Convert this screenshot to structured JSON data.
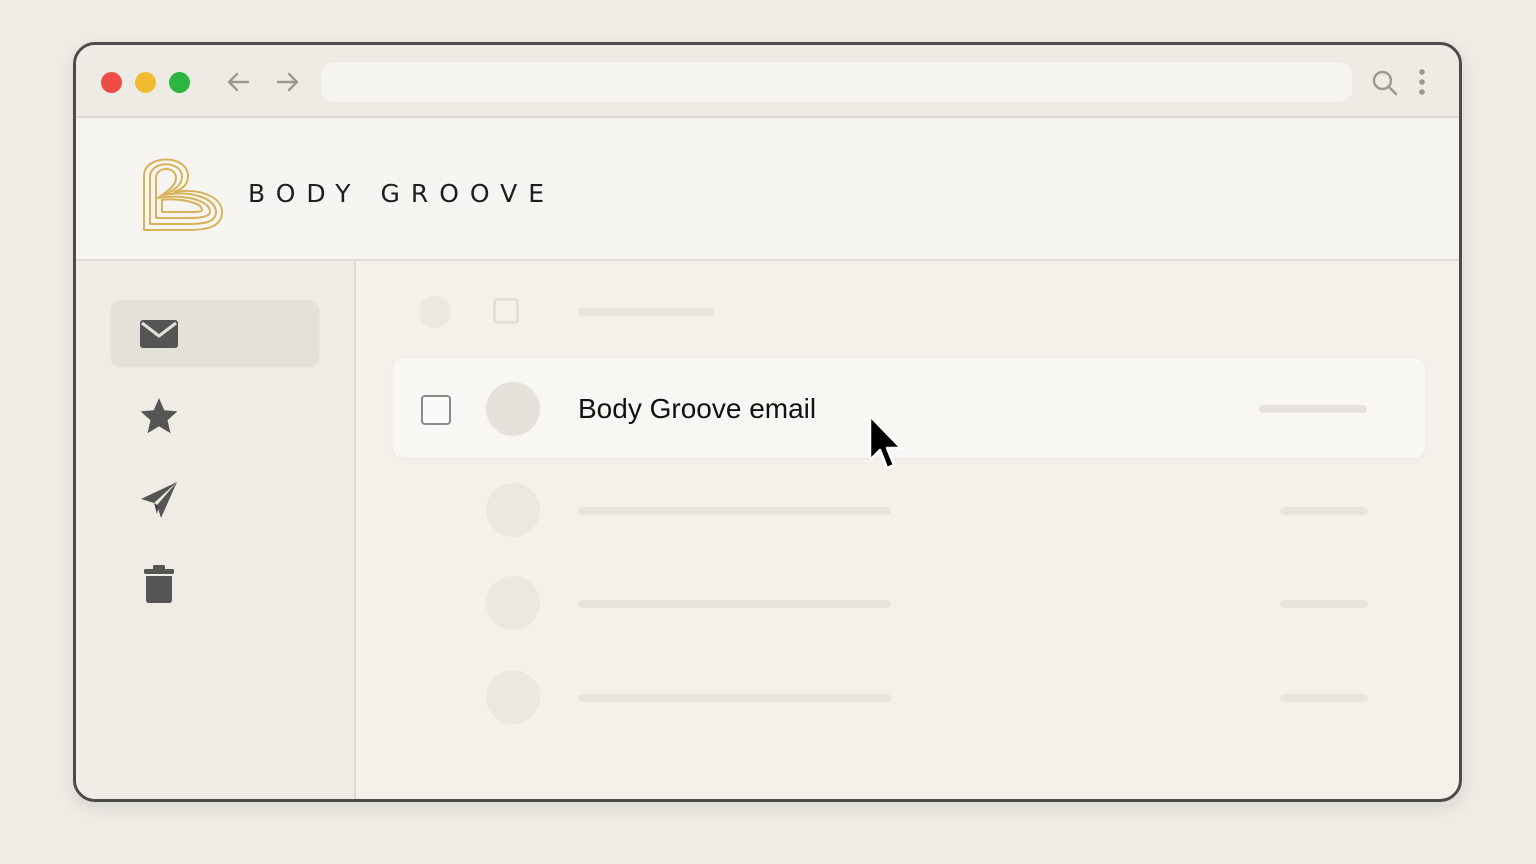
{
  "browser": {
    "traffic_lights": [
      "red",
      "yellow",
      "green"
    ],
    "back_icon": "arrow-left-icon",
    "forward_icon": "arrow-right-icon",
    "address": "",
    "search_icon": "search-icon",
    "menu_icon": "kebab-menu-icon"
  },
  "header": {
    "brand": "BODY GROOVE",
    "logo_icon": "body-groove-logo"
  },
  "sidebar": {
    "items": [
      {
        "icon": "mail-icon",
        "active": true
      },
      {
        "icon": "star-icon",
        "active": false
      },
      {
        "icon": "send-icon",
        "active": false
      },
      {
        "icon": "trash-icon",
        "active": false
      }
    ]
  },
  "inbox": {
    "highlighted_email": {
      "subject": "Body Groove email"
    }
  },
  "colors": {
    "page_bg": "#efece6",
    "window_border": "#4b4b4b",
    "logo_gold": "#d7b25a",
    "icon_gray": "#555555",
    "active_item_bg": "#e4e1d9"
  }
}
